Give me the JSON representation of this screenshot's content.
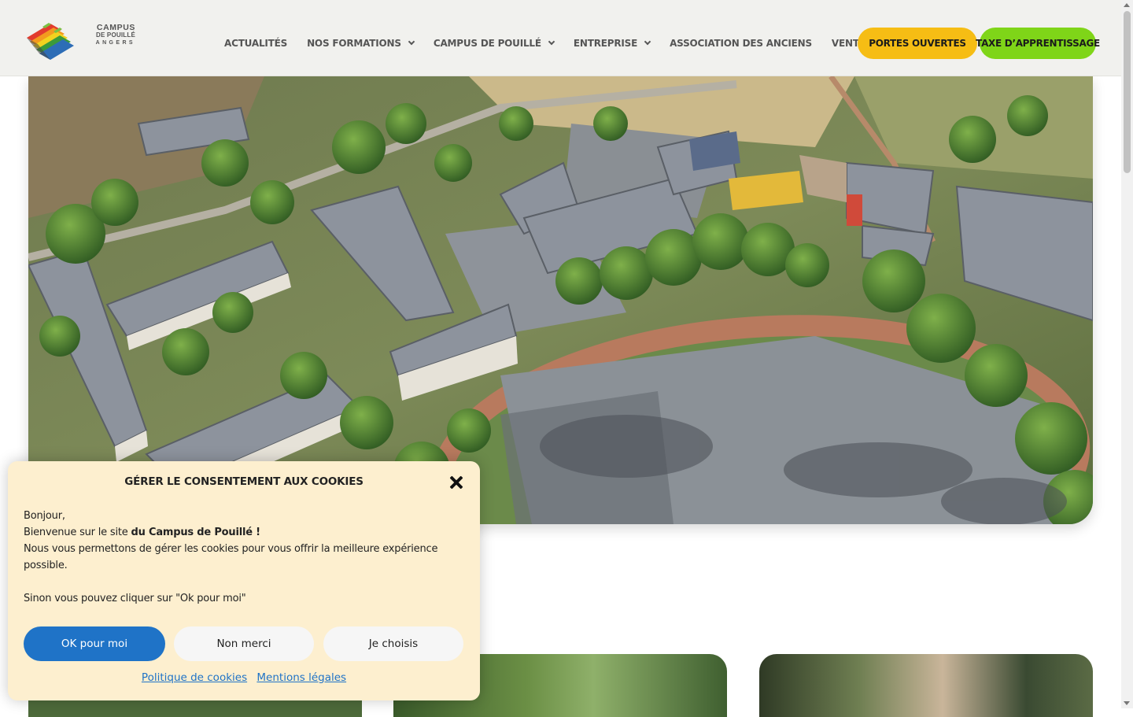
{
  "header": {
    "logo": {
      "line1": "CAMPUS",
      "line2": "DE POUILLÉ",
      "line3": "ANGERS"
    },
    "nav": [
      {
        "label": "ACTUALITÉS",
        "has_dropdown": false
      },
      {
        "label": "NOS FORMATIONS",
        "has_dropdown": true
      },
      {
        "label": "CAMPUS DE POUILLÉ",
        "has_dropdown": true
      },
      {
        "label": "ENTREPRISE",
        "has_dropdown": true
      },
      {
        "label": "ASSOCIATION DES ANCIENS",
        "has_dropdown": false
      },
      {
        "label": "VENTE DIRECTE",
        "has_dropdown": false
      }
    ],
    "cta_portes": "PORTES OUVERTES",
    "cta_taxe": "TAXE D’APPRENTISSAGE"
  },
  "colors": {
    "portes": "#f6bd14",
    "taxe": "#7fd518",
    "link": "#1f73c7",
    "modal_bg": "#fdefcf"
  },
  "cookie": {
    "title": "GÉRER LE CONSENTEMENT AUX COOKIES",
    "greeting": "Bonjour,",
    "welcome_prefix": "Bienvenue sur le site ",
    "welcome_bold": "du Campus de Pouillé !",
    "message": "Nous vous permettons de gérer les cookies pour vous offrir la meilleure expérience possible.",
    "alt_message": "Sinon vous pouvez cliquer sur \"Ok pour moi\"",
    "btn_ok": "OK pour moi",
    "btn_no": "Non merci",
    "btn_choose": "Je choisis",
    "link_policy": "Politique de cookies",
    "link_legal": "Mentions légales"
  },
  "icons": [
    "campus-logo-icon",
    "chevron-down-icon",
    "close-icon"
  ]
}
